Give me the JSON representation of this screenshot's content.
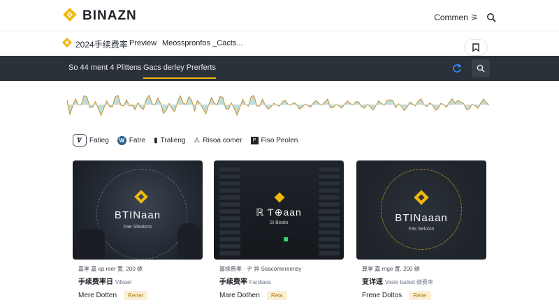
{
  "header": {
    "brand": "BINAZN",
    "community_label": "Commen",
    "community_glyph": "⚞",
    "logo_color": "#f0b90b",
    "icons": [
      "binance-logo-icon",
      "search-icon"
    ]
  },
  "subheader": {
    "title": "2024手续费率",
    "preview": "Preview",
    "more": "Meosspronfos _Cacts..."
  },
  "darkbar": {
    "tab_left": "So 44 ment 4 Plittens",
    "tab_active": "Gacs derley Prerferts",
    "accent": "#f0b90b",
    "background": "#2b3139"
  },
  "filters": [
    {
      "icon_text": "Ꮴ",
      "label": "Fatieg",
      "icon": "filter-icon"
    },
    {
      "icon_text": "W",
      "label": "Fatre",
      "icon": "circle-badge-icon"
    },
    {
      "icon_text": "▮",
      "label": "Tralieng",
      "icon": "bar-icon"
    },
    {
      "icon_text": "⚠",
      "label": "Risoa comer",
      "icon": "warning-icon"
    },
    {
      "icon_text": "P",
      "label": "Fiso Peolen",
      "icon": "square-badge-icon"
    }
  ],
  "cards": [
    {
      "image_brand": "BTINaan",
      "image_sub": "Fae Sleaions",
      "meta": "嘉享 嘉 ep reer 置, 200 绩",
      "title": "手续费率日",
      "title_note": "Vilkael",
      "footer": "Mere Dotten",
      "tag": "Rerter"
    },
    {
      "image_brand": "ℝ Ƭ⊕aan",
      "image_sub": "SI Boato",
      "meta": "嘼续费率 · ヂ 异 Seacomereensy",
      "title": "手续费率",
      "title_note": "Fardiaes",
      "footer": "Mare Dothen",
      "tag": "Reta"
    },
    {
      "image_brand": "BTINaaan",
      "image_sub": "Fas Seloion",
      "meta": "算享 嘉 rnge 置, 200 绩",
      "title": "变详逕",
      "title_note": "Vasie bailed 绩费率",
      "footer": "Frene Doltos",
      "tag": "Reter"
    }
  ]
}
